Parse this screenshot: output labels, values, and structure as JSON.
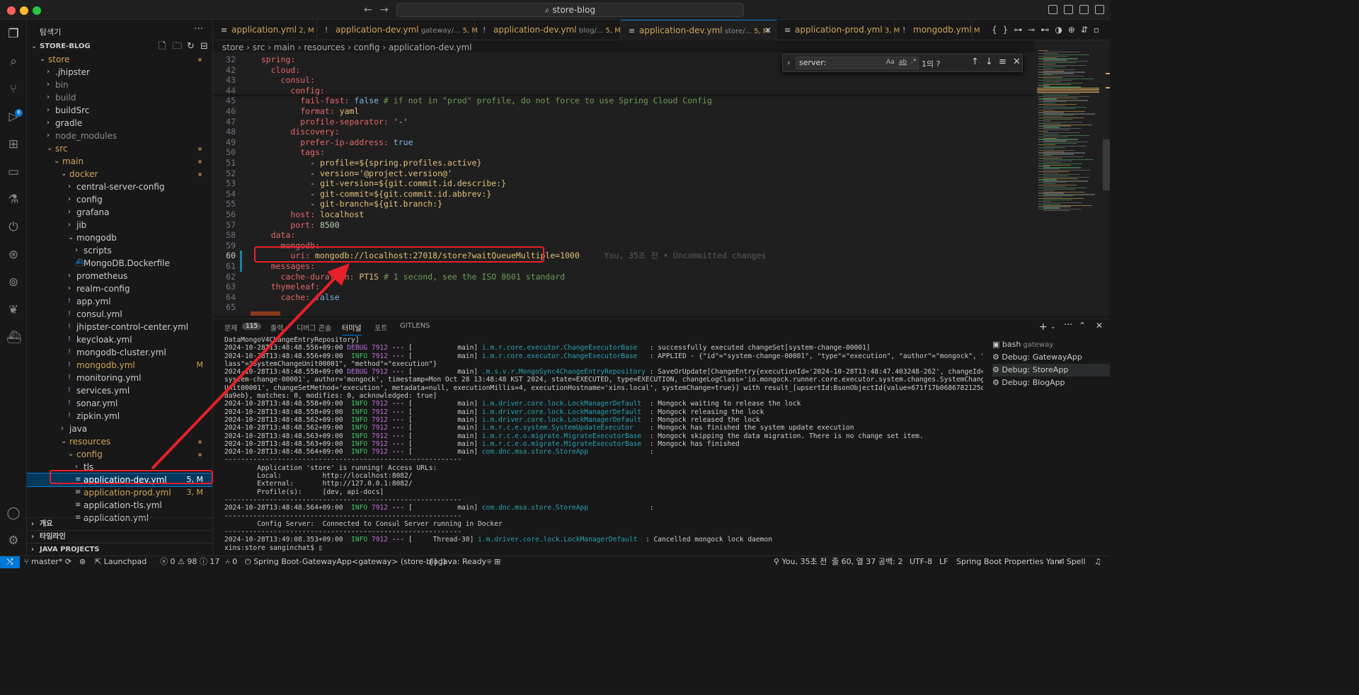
{
  "window": {
    "search_text": "store-blog",
    "search_icon": "search-icon"
  },
  "sidebar": {
    "title": "탐색기",
    "root": "STORE-BLOG",
    "tree": [
      {
        "label": "store",
        "indent": 1,
        "open": true,
        "color": "#d1a35a",
        "mod": true
      },
      {
        "label": ".jhipster",
        "indent": 2,
        "open": false,
        "color": "#cccccc"
      },
      {
        "label": "bin",
        "indent": 2,
        "open": false,
        "color": "#8b8b8b"
      },
      {
        "label": "build",
        "indent": 2,
        "open": false,
        "color": "#8b8b8b"
      },
      {
        "label": "buildSrc",
        "indent": 2,
        "open": false,
        "color": "#cccccc"
      },
      {
        "label": "gradle",
        "indent": 2,
        "open": false,
        "color": "#cccccc"
      },
      {
        "label": "node_modules",
        "indent": 2,
        "open": false,
        "color": "#8b8b8b"
      },
      {
        "label": "src",
        "indent": 2,
        "open": true,
        "color": "#d1a35a",
        "mod": true
      },
      {
        "label": "main",
        "indent": 3,
        "open": true,
        "color": "#d1a35a",
        "mod": true
      },
      {
        "label": "docker",
        "indent": 4,
        "open": true,
        "color": "#d1a35a",
        "mod": true
      },
      {
        "label": "central-server-config",
        "indent": 5,
        "open": false,
        "color": "#cccccc"
      },
      {
        "label": "config",
        "indent": 5,
        "open": false,
        "color": "#cccccc"
      },
      {
        "label": "grafana",
        "indent": 5,
        "open": false,
        "color": "#cccccc"
      },
      {
        "label": "jib",
        "indent": 5,
        "open": false,
        "color": "#cccccc"
      },
      {
        "label": "mongodb",
        "indent": 5,
        "open": true,
        "color": "#cccccc"
      },
      {
        "label": "scripts",
        "indent": 6,
        "open": false,
        "color": "#cccccc"
      },
      {
        "label": "MongoDB.Dockerfile",
        "indent": 6,
        "file": "docker",
        "color": "#cccccc"
      },
      {
        "label": "prometheus",
        "indent": 5,
        "open": false,
        "color": "#cccccc"
      },
      {
        "label": "realm-config",
        "indent": 5,
        "open": false,
        "color": "#cccccc"
      },
      {
        "label": "app.yml",
        "indent": 5,
        "file": "yml",
        "color": "#cccccc"
      },
      {
        "label": "consul.yml",
        "indent": 5,
        "file": "yml",
        "color": "#cccccc"
      },
      {
        "label": "jhipster-control-center.yml",
        "indent": 5,
        "file": "yml",
        "color": "#cccccc"
      },
      {
        "label": "keycloak.yml",
        "indent": 5,
        "file": "yml",
        "color": "#cccccc"
      },
      {
        "label": "mongodb-cluster.yml",
        "indent": 5,
        "file": "yml",
        "color": "#cccccc"
      },
      {
        "label": "mongodb.yml",
        "indent": 5,
        "file": "yml",
        "color": "#d1a35a",
        "badge": "M"
      },
      {
        "label": "monitoring.yml",
        "indent": 5,
        "file": "yml",
        "color": "#cccccc"
      },
      {
        "label": "services.yml",
        "indent": 5,
        "file": "yml",
        "color": "#cccccc"
      },
      {
        "label": "sonar.yml",
        "indent": 5,
        "file": "yml",
        "color": "#cccccc"
      },
      {
        "label": "zipkin.yml",
        "indent": 5,
        "file": "yml",
        "color": "#cccccc"
      },
      {
        "label": "java",
        "indent": 4,
        "open": false,
        "color": "#cccccc"
      },
      {
        "label": "resources",
        "indent": 4,
        "open": true,
        "color": "#d1a35a",
        "mod": true
      },
      {
        "label": "config",
        "indent": 5,
        "open": true,
        "color": "#d1a35a",
        "mod": true
      },
      {
        "label": "tls",
        "indent": 6,
        "open": false,
        "color": "#cccccc"
      },
      {
        "label": "application-dev.yml",
        "indent": 6,
        "file": "lines",
        "color": "#ffffff",
        "badge": "5, M",
        "selected": true
      },
      {
        "label": "application-prod.yml",
        "indent": 6,
        "file": "lines",
        "color": "#d1a35a",
        "badge": "3, M"
      },
      {
        "label": "application-tls.yml",
        "indent": 6,
        "file": "lines",
        "color": "#cccccc"
      },
      {
        "label": "application.yml",
        "indent": 6,
        "file": "lines",
        "color": "#cccccc"
      }
    ],
    "sections": [
      "개요",
      "타임라인",
      "JAVA PROJECTS"
    ]
  },
  "tabs": [
    {
      "name": "application.yml",
      "sub": "",
      "mod": "2, M",
      "icon": "lines"
    },
    {
      "name": "application-dev.yml",
      "sub": "gateway/...",
      "mod": "5, M",
      "icon": "excl"
    },
    {
      "name": "application-dev.yml",
      "sub": "blog/...",
      "mod": "5, M",
      "icon": "excl"
    },
    {
      "name": "application-dev.yml",
      "sub": "store/...",
      "mod": "5, M",
      "icon": "lines",
      "active": true
    },
    {
      "name": "application-prod.yml",
      "sub": "",
      "mod": "3, M",
      "icon": "lines"
    },
    {
      "name": "mongodb.yml",
      "sub": "",
      "mod": "M",
      "icon": "excl"
    }
  ],
  "breadcrumb": [
    "store",
    "src",
    "main",
    "resources",
    "config",
    "application-dev.yml"
  ],
  "find": {
    "value": "server:",
    "result": "1의 ?",
    "opt_case": "Aa",
    "opt_word": "ab",
    "opt_regex": ".*"
  },
  "code": [
    {
      "n": "32",
      "segs": [
        [
          "  ",
          ""
        ],
        [
          "spring:",
          "k"
        ]
      ]
    },
    {
      "n": "42",
      "segs": [
        [
          "    ",
          ""
        ],
        [
          "cloud:",
          "k"
        ]
      ]
    },
    {
      "n": "43",
      "segs": [
        [
          "      ",
          ""
        ],
        [
          "consul:",
          "k"
        ]
      ]
    },
    {
      "n": "44",
      "segs": [
        [
          "        ",
          ""
        ],
        [
          "config:",
          "k"
        ]
      ]
    },
    {
      "n": "45",
      "segs": [
        [
          "          ",
          ""
        ],
        [
          "fail-fast:",
          "k"
        ],
        [
          " false ",
          "t"
        ],
        [
          "# if not in \"prod\" profile, do not force to use Spring Cloud Config",
          "c"
        ]
      ]
    },
    {
      "n": "46",
      "segs": [
        [
          "          ",
          ""
        ],
        [
          "format:",
          "k"
        ],
        [
          " yaml",
          "s"
        ]
      ]
    },
    {
      "n": "47",
      "segs": [
        [
          "          ",
          ""
        ],
        [
          "profile-separator:",
          "k"
        ],
        [
          " '-'",
          "s"
        ]
      ]
    },
    {
      "n": "48",
      "segs": [
        [
          "        ",
          ""
        ],
        [
          "discovery:",
          "k"
        ]
      ]
    },
    {
      "n": "49",
      "segs": [
        [
          "          ",
          ""
        ],
        [
          "prefer-ip-address:",
          "k"
        ],
        [
          " true",
          "t"
        ]
      ]
    },
    {
      "n": "50",
      "segs": [
        [
          "          ",
          ""
        ],
        [
          "tags:",
          "k"
        ]
      ]
    },
    {
      "n": "51",
      "segs": [
        [
          "            - ",
          ""
        ],
        [
          "profile=${spring.profiles.active}",
          "s"
        ]
      ]
    },
    {
      "n": "52",
      "segs": [
        [
          "            - ",
          ""
        ],
        [
          "version='@project.version@'",
          "s"
        ]
      ]
    },
    {
      "n": "53",
      "segs": [
        [
          "            - ",
          ""
        ],
        [
          "git-version=${git.commit.id.describe:}",
          "s"
        ]
      ]
    },
    {
      "n": "54",
      "segs": [
        [
          "            - ",
          ""
        ],
        [
          "git-commit=${git.commit.id.abbrev:}",
          "s"
        ]
      ]
    },
    {
      "n": "55",
      "segs": [
        [
          "            - ",
          ""
        ],
        [
          "git-branch=${git.branch:}",
          "s"
        ]
      ]
    },
    {
      "n": "56",
      "segs": [
        [
          "        ",
          ""
        ],
        [
          "host:",
          "k"
        ],
        [
          " localhost",
          "s"
        ]
      ]
    },
    {
      "n": "57",
      "segs": [
        [
          "        ",
          ""
        ],
        [
          "port:",
          "k"
        ],
        [
          " 8500",
          "n"
        ]
      ]
    },
    {
      "n": "58",
      "segs": [
        [
          "    ",
          ""
        ],
        [
          "data:",
          "k"
        ]
      ]
    },
    {
      "n": "59",
      "segs": [
        [
          "      ",
          ""
        ],
        [
          "mongodb:",
          "k"
        ]
      ]
    },
    {
      "n": "60",
      "segs": [
        [
          "        ",
          ""
        ],
        [
          "uri:",
          "k"
        ],
        [
          " mongodb://localhost:27018/store?waitQueueMultiple=1000",
          "s"
        ]
      ]
    },
    {
      "n": "61",
      "segs": [
        [
          "    ",
          ""
        ],
        [
          "messages:",
          "k"
        ]
      ]
    },
    {
      "n": "62",
      "segs": [
        [
          "      ",
          ""
        ],
        [
          "cache-duration:",
          "k"
        ],
        [
          " PT1S ",
          "s"
        ],
        [
          "# 1 second, see the ISO 8601 standard",
          "c"
        ]
      ]
    },
    {
      "n": "63",
      "segs": [
        [
          "    ",
          ""
        ],
        [
          "thymeleaf:",
          "k"
        ]
      ]
    },
    {
      "n": "64",
      "segs": [
        [
          "      ",
          ""
        ],
        [
          "cache:",
          "k"
        ],
        [
          " false",
          "t"
        ]
      ]
    },
    {
      "n": "65",
      "segs": []
    }
  ],
  "blame": "You, 35초 전 • Uncommitted changes",
  "panel": {
    "tabs": [
      "문제",
      "115",
      "출력",
      "디버그 콘솔",
      "터미널",
      "포트",
      "GITLENS"
    ],
    "active_tab": "터미널",
    "terminal_lines": [
      "DataMongoV4ChangeEntryRepository]",
      "2024-10-28T13:48:48.556+09:00 DEBUG 7912 --- [           main] i.m.r.core.executor.ChangeExecutorBase   : successfully executed changeSet[system-change-00001]",
      "2024-10-28T13:48:48.556+09:00  INFO 7912 --- [           main] i.m.r.core.executor.ChangeExecutorBase   : APPLIED - {\"id\"=\"system-change-00001\", \"type\"=\"execution\", \"author\"=\"mongock\", \"c",
      "lass\"=\"SystemChangeUnit00001\", \"method\"=\"execution\"}",
      "2024-10-28T13:48:48.558+09:00 DEBUG 7912 --- [           main] .m.s.v.r.MongoSync4ChangeEntryRepository : SaveOrUpdate[ChangeEntry{executionId='2024-10-28T13:48:47.403248-262', changeId='",
      "system-change-00001', author='mongock', timestamp=Mon Oct 28 13:48:48 KST 2024, state=EXECUTED, type=EXECUTION, changeLogClass='io.mongock.runner.core.executor.system.changes.SystemChange",
      "Unit00001', changeSetMethod='execution', metadata=null, executionMillis=4, executionHostname='xins.local', systemChange=true}] with result_[upsertId:BsonObjectId{value=671f17b0686782125db",
      "8a9eb}, matches: 0, modifies: 0, acknowledged: true]",
      "2024-10-28T13:48:48.558+09:00  INFO 7912 --- [           main] i.m.driver.core.lock.LockManagerDefault  : Mongock waiting to release the lock",
      "2024-10-28T13:48:48.558+09:00  INFO 7912 --- [           main] i.m.driver.core.lock.LockManagerDefault  : Mongock releasing the lock",
      "2024-10-28T13:48:48.562+09:00  INFO 7912 --- [           main] i.m.driver.core.lock.LockManagerDefault  : Mongock released the lock",
      "2024-10-28T13:48:48.562+09:00  INFO 7912 --- [           main] i.m.r.c.e.system.SystemUpdateExecutor    : Mongock has finished the system update execution",
      "2024-10-28T13:48:48.563+09:00  INFO 7912 --- [           main] i.m.r.c.e.o.migrate.MigrateExecutorBase  : Mongock skipping the data migration. There is no change set item.",
      "2024-10-28T13:48:48.563+09:00  INFO 7912 --- [           main] i.m.r.c.e.o.migrate.MigrateExecutorBase  : Mongock has finished",
      "2024-10-28T13:48:48.564+09:00  INFO 7912 --- [           main] com.dnc.msa.store.StoreApp               :",
      "----------------------------------------------------------",
      "        Application 'store' is running! Access URLs:",
      "        Local:          http://localhost:8082/",
      "        External:       http://127.0.0.1:8082/",
      "        Profile(s):     [dev, api-docs]",
      "----------------------------------------------------------",
      "2024-10-28T13:48:48.564+09:00  INFO 7912 --- [           main] com.dnc.msa.store.StoreApp               :",
      "----------------------------------------------------------",
      "        Config Server:  Connected to Consul Server running in Docker",
      "----------------------------------------------------------",
      "2024-10-28T13:49:08.353+09:00  INFO 7912 --- [     Thread-30] i.m.driver.core.lock.LockManagerDefault  : Cancelled mongock lock daemon",
      "xins:store sanginchat$ ▯"
    ],
    "terminal_list": [
      {
        "label": "bash",
        "sub": "gateway",
        "icon": "terminal"
      },
      {
        "label": "Debug: GatewayApp",
        "icon": "debug"
      },
      {
        "label": "Debug: StoreApp",
        "icon": "debug",
        "active": true
      },
      {
        "label": "Debug: BlogApp",
        "icon": "debug"
      }
    ]
  },
  "status": {
    "branch": "master*",
    "launchpad": "Launchpad",
    "errors": "0",
    "warnings": "98",
    "infos": "17",
    "ports": "0",
    "spring": "Spring Boot-GatewayApp<gateway> (store-blog)",
    "java": "Java: Ready",
    "blame": "You, 35초 전",
    "position": "줄 60, 열 37",
    "spaces": "공백: 2",
    "encoding": "UTF-8",
    "eol": "LF",
    "lang": "Spring Boot Properties Yaml",
    "spell": "Spell"
  },
  "colors": {
    "accent": "#0078d4",
    "modified": "#d1a35a",
    "annotation": "#e8202a"
  }
}
